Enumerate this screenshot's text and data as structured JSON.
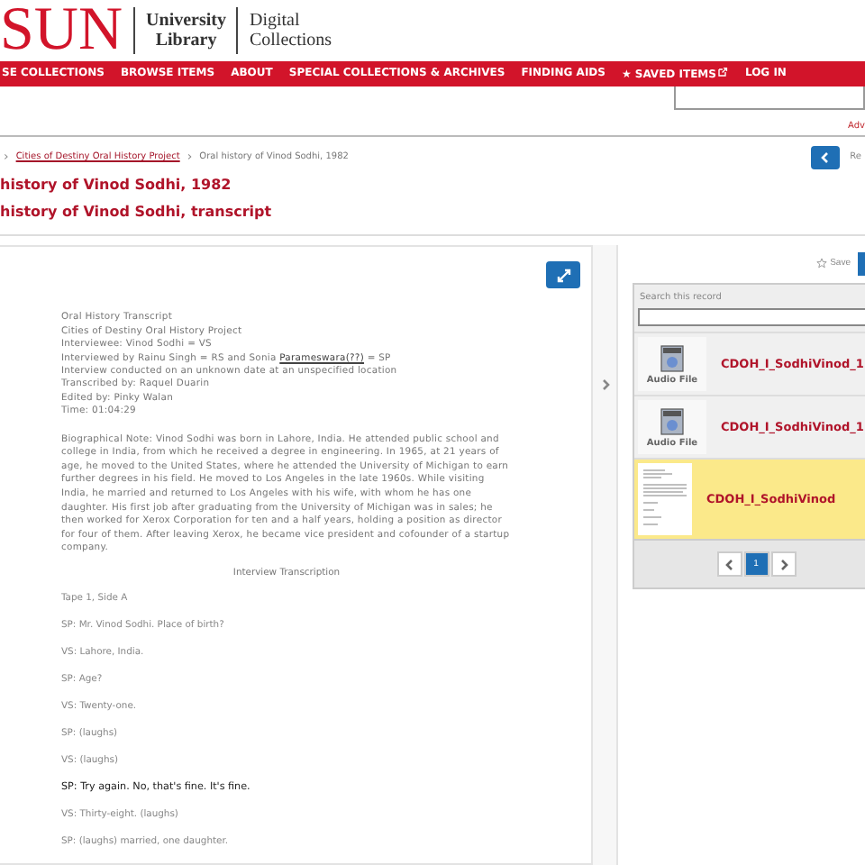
{
  "header": {
    "logo": "SUN",
    "library": [
      "University",
      "Library"
    ],
    "collections": [
      "Digital",
      "Collections"
    ]
  },
  "nav": [
    {
      "label": "SE COLLECTIONS",
      "kind": "link"
    },
    {
      "label": "BROWSE ITEMS",
      "kind": "link"
    },
    {
      "label": "ABOUT",
      "kind": "link"
    },
    {
      "label": "SPECIAL COLLECTIONS & ARCHIVES",
      "kind": "link"
    },
    {
      "label": "FINDING AIDS",
      "kind": "link"
    },
    {
      "label": "SAVED ITEMS",
      "kind": "saved",
      "icon": "★"
    },
    {
      "label": "LOG IN",
      "kind": "link"
    }
  ],
  "advanced_link": "Adv",
  "breadcrumb": [
    {
      "sep": "›",
      "label": "Cities of Destiny Oral History Project",
      "kind": "link"
    },
    {
      "sep": "›",
      "label": "Oral history of Vinod Sodhi, 1982",
      "kind": "current"
    }
  ],
  "back_label": "Re",
  "titles": [
    "history of Vinod Sodhi, 1982",
    "history of Vinod Sodhi, transcript"
  ],
  "transcript": {
    "header_lines": [
      "Oral History Transcript",
      "Cities of Destiny Oral History Project",
      "Interviewee: Vinod Sodhi = VS"
    ],
    "interviewer_line": {
      "before": "Interviewed by Rainu Singh = RS and Sonia ",
      "link": "Parameswara(??)",
      "after": " = SP"
    },
    "more_lines": [
      "Interview conducted on an unknown date at an unspecified location",
      "Transcribed by: Raquel Duarin",
      "Edited by: Pinky Walan",
      "Time: 01:04:29"
    ],
    "bio": "Biographical Note: Vinod Sodhi was born in Lahore, India. He attended public school and college in India, from which he received a degree in engineering. In 1965, at 21 years of age, he moved to the United States, where he attended the University of Michigan to earn further degrees in his field. He moved to Los Angeles in the late 1960s. While visiting India, he married and returned to Los Angeles with his wife, with whom he has one daughter. His first job after graduating from the University of Michigan was in sales; he then worked for Xerox Corporation for ten and a half years, holding a position as director for four of them. After leaving Xerox, he became vice president and cofounder of a startup company.",
    "section_title": "Interview Transcription",
    "lines": [
      {
        "text": "Tape 1, Side A",
        "kind": "plain"
      },
      {
        "text": "SP: Mr. Vinod Sodhi. Place of birth?",
        "kind": "plain"
      },
      {
        "text": "VS: Lahore, India.",
        "kind": "plain"
      },
      {
        "text": "SP: Age?",
        "kind": "plain"
      },
      {
        "text": "VS: Twenty-one.",
        "kind": "plain"
      },
      {
        "text": "SP: (laughs)",
        "kind": "plain"
      },
      {
        "text": "VS: (laughs)",
        "kind": "plain"
      },
      {
        "text": "SP: Try again. No, that's fine. It's fine.",
        "kind": "dark"
      },
      {
        "text": "VS: Thirty-eight. (laughs)",
        "kind": "plain"
      },
      {
        "text": "SP: (laughs) married, one daughter.",
        "kind": "plain"
      }
    ]
  },
  "sidebar": {
    "save": "Save",
    "search_label": "Search this record",
    "items": [
      {
        "title": "CDOH_I_SodhiVinod_1",
        "thumb_label": "Audio File",
        "kind": "audio",
        "selected": false
      },
      {
        "title": "CDOH_I_SodhiVinod_1",
        "thumb_label": "Audio File",
        "kind": "audio",
        "selected": false
      },
      {
        "title": "CDOH_I_SodhiVinod",
        "kind": "document",
        "selected": true
      }
    ],
    "pages": [
      {
        "label": "1",
        "selected": true
      }
    ]
  }
}
